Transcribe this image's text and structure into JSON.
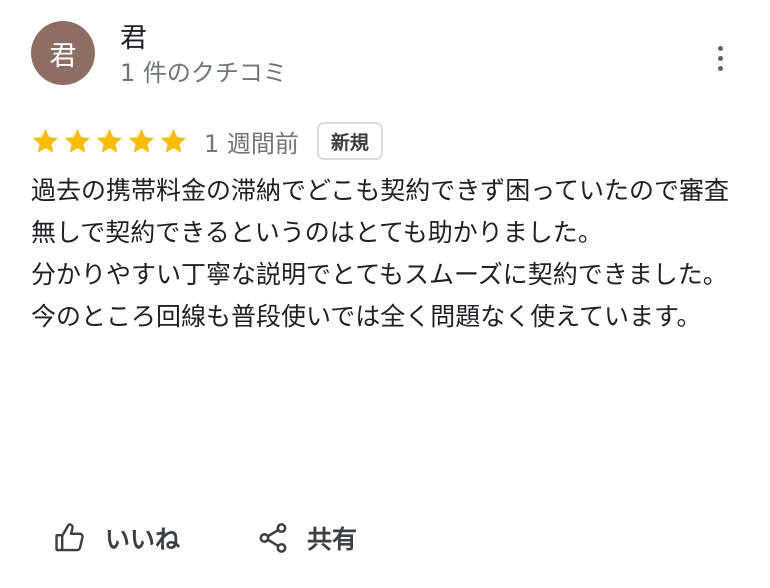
{
  "reviewer": {
    "avatar_initial": "君",
    "avatar_color": "#8d6e63",
    "name": "君",
    "meta": "1 件のクチコミ"
  },
  "rating": {
    "stars": 5,
    "star_color": "#fbbc04",
    "time": "1 週間前",
    "badge": "新規"
  },
  "review": {
    "paragraphs": [
      "過去の携帯料金の滞納でどこも契約できず困っていたので審査無しで契約できるというのはとても助かりました。",
      "分かりやすい丁寧な説明でとてもスムーズに契約できました。",
      "今のところ回線も普段使いでは全く問題なく使えています。"
    ]
  },
  "actions": {
    "like_label": "いいね",
    "share_label": "共有"
  },
  "icons": {
    "more": "more-vert-icon",
    "star": "star-icon",
    "like": "thumb-up-icon",
    "share": "share-icon"
  }
}
